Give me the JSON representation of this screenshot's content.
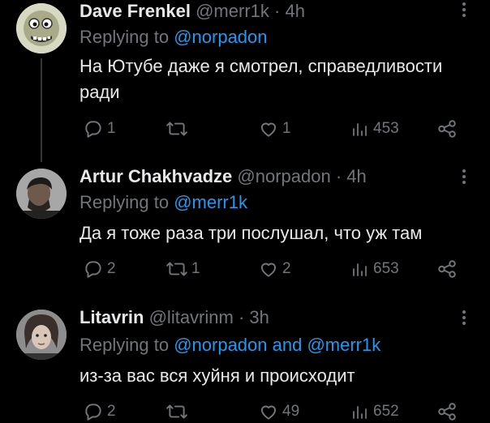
{
  "tweets": [
    {
      "name": "Dave Frenkel",
      "handle": "@merr1k",
      "time": "· 4h",
      "replying_prefix": "Replying to",
      "replying_to": "@norpadon",
      "text": "На Ютубе даже я смотрел, справедливости ради",
      "replies": "1",
      "retweets": "",
      "likes": "1",
      "views": "453",
      "avatar_icon": "cartoon-face-icon"
    },
    {
      "name": "Artur Chakhvadze",
      "handle": "@norpadon",
      "time": "· 4h",
      "replying_prefix": "Replying to",
      "replying_to": "@merr1k",
      "text": "Да я тоже раза три послушал, что уж там",
      "replies": "2",
      "retweets": "1",
      "likes": "2",
      "views": "653",
      "avatar_icon": "profile-photo"
    },
    {
      "name": "Litavrin",
      "handle": "@litavrinm",
      "time": "· 3h",
      "replying_prefix": "Replying to",
      "replying_to": "@norpadon and @merr1k",
      "text": "из-за вас вся хуйня и происходит",
      "replies": "2",
      "retweets": "",
      "likes": "49",
      "views": "652",
      "avatar_icon": "profile-photo"
    }
  ],
  "colors": {
    "background": "#000000",
    "text": "#e7e9ea",
    "secondary": "#71767b",
    "accent": "#1d9bf0",
    "thread_line": "#333639"
  }
}
